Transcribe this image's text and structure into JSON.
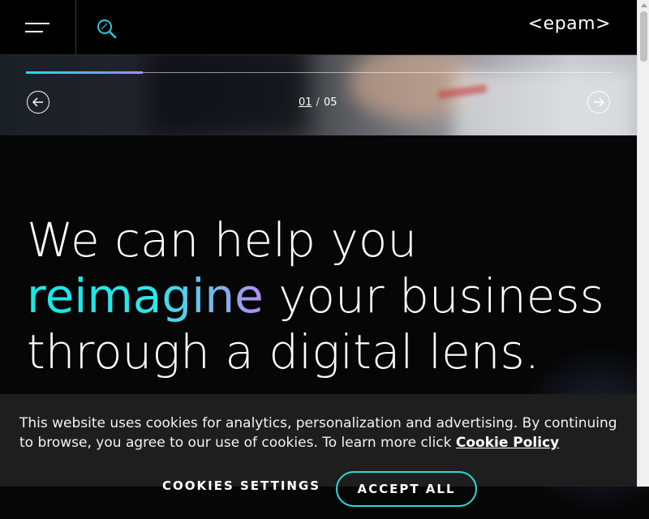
{
  "header": {
    "logo": "<epam>",
    "menu_icon": "hamburger-icon",
    "search_icon": "search-icon"
  },
  "carousel": {
    "current": "01",
    "separator": "/",
    "total": "05",
    "progress": 0.2,
    "prev_icon": "arrow-left-icon",
    "next_icon": "arrow-right-icon"
  },
  "hero": {
    "line1": "We can help you",
    "highlight": "reimagine",
    "line2_rest": " your business",
    "line3": "through a digital lens."
  },
  "cookie_banner": {
    "text": "This website uses cookies for analytics, personalization and advertising. By continuing to browse, you agree to our use of cookies. To learn more click ",
    "link_label": "Cookie Policy",
    "settings_label": "COOKIES SETTINGS",
    "accept_label": "ACCEPT ALL"
  },
  "colors": {
    "accent_cyan": "#14e3e6",
    "accent_violet": "#a98cf0",
    "background": "#060606"
  }
}
